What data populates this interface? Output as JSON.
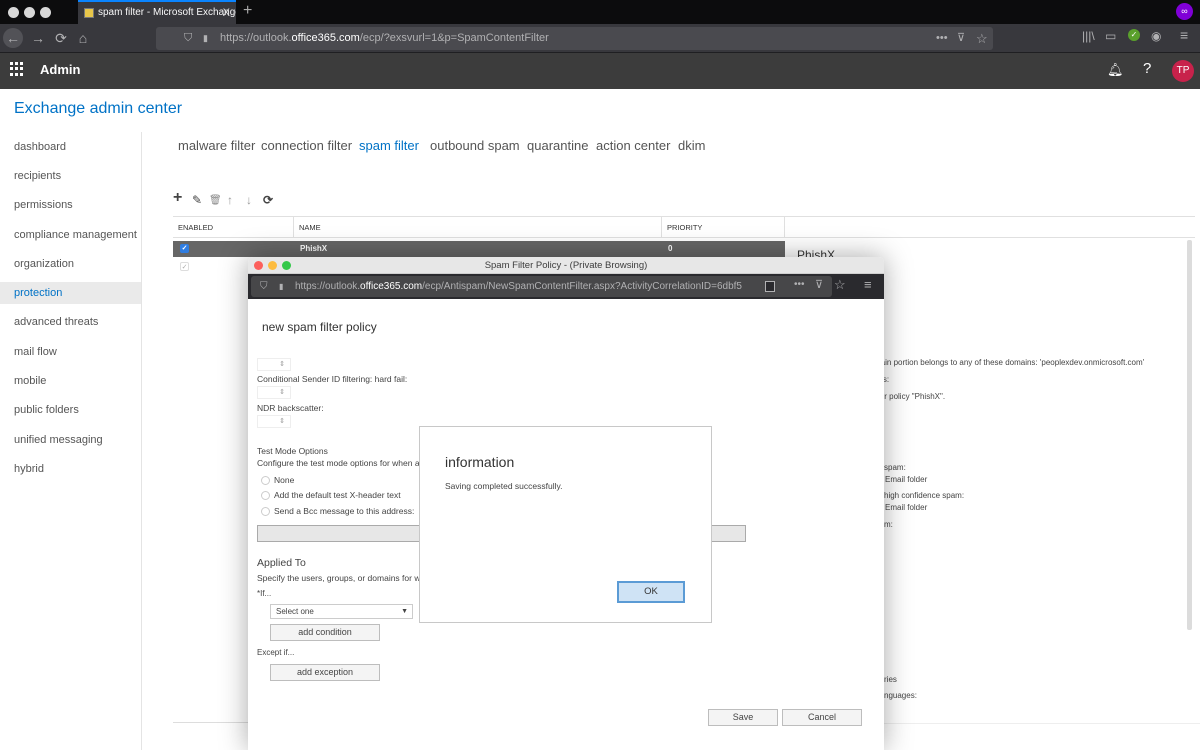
{
  "browser": {
    "tab_title": "spam filter - Microsoft Exchange",
    "tab_close": "X",
    "new_tab": "+",
    "url_prefix": "https://outlook.",
    "url_host": "office365.com",
    "url_path": "/ecp/?exsvurl=1&p=SpamContentFilter",
    "icons": {
      "back": "←",
      "forward": "→",
      "reload": "⟳",
      "home": "⌂",
      "shield": "⛉",
      "lock": "🔒",
      "more": "•••",
      "pocket": "⊽",
      "star": "☆",
      "library": "|||\\",
      "sidebar": "▭",
      "extension": "✓",
      "account": "◉",
      "menu": "≡",
      "private": "∞"
    }
  },
  "o365": {
    "app_name": "Admin",
    "bell_icon": "🔔",
    "help_icon": "?",
    "avatar_initials": "TP"
  },
  "eac": {
    "title": "Exchange admin center",
    "sidebar": [
      {
        "label": "dashboard"
      },
      {
        "label": "recipients"
      },
      {
        "label": "permissions"
      },
      {
        "label": "compliance management"
      },
      {
        "label": "organization"
      },
      {
        "label": "protection",
        "active": true
      },
      {
        "label": "advanced threats"
      },
      {
        "label": "mail flow"
      },
      {
        "label": "mobile"
      },
      {
        "label": "public folders"
      },
      {
        "label": "unified messaging"
      },
      {
        "label": "hybrid"
      }
    ],
    "subtabs": [
      {
        "label": "malware filter"
      },
      {
        "label": "connection filter"
      },
      {
        "label": "spam filter",
        "active": true
      },
      {
        "label": "outbound spam"
      },
      {
        "label": "quarantine"
      },
      {
        "label": "action center"
      },
      {
        "label": "dkim"
      }
    ],
    "toolbar": {
      "add": "+",
      "edit": "✎",
      "delete": "🗑",
      "up": "↑",
      "down": "↓",
      "refresh": "⟳"
    },
    "table": {
      "columns": [
        "ENABLED",
        "NAME",
        "PRIORITY"
      ],
      "rows": [
        {
          "enabled": true,
          "name": "PhishX",
          "priority": "0",
          "selected": true
        },
        {
          "enabled": true,
          "name": "",
          "priority": ""
        }
      ]
    },
    "details": {
      "title": "PhishX",
      "lines": [
        "main portion belongs to any of these domains: 'peoplexdev.onmicrosoft.com'",
        "ons:",
        "ilter policy \"PhishX\".",
        "spam:",
        "Email folder",
        "high confidence spam:",
        "Email folder",
        "m:",
        "ries",
        "nguages:"
      ]
    }
  },
  "popup": {
    "window_title": "Spam Filter Policy - (Private Browsing)",
    "url_prefix": "https://outlook.",
    "url_host": "office365.com",
    "url_path": "/ecp/Antispam/NewSpamContentFilter.aspx?ActivityCorrelationID=6dbf5",
    "heading": "new spam filter policy",
    "labels": {
      "sender_id": "Conditional Sender ID filtering: hard fail:",
      "ndr": "NDR backscatter:",
      "test_mode": "Test Mode Options",
      "test_mode_desc": "Configure the test mode options for when a",
      "applied_to": "Applied To",
      "applied_desc": "Specify the users, groups, or domains for w",
      "if": "*If...",
      "except_if": "Except if..."
    },
    "radio_options": [
      {
        "label": "None"
      },
      {
        "label": "Add the default test X-header text"
      },
      {
        "label": "Send a Bcc message to this address:"
      }
    ],
    "bcc_value": "",
    "condition_select": "Select one",
    "add_condition": "add condition",
    "add_exception": "add exception",
    "save": "Save",
    "cancel": "Cancel"
  },
  "info_dialog": {
    "title": "information",
    "message": "Saving completed successfully.",
    "ok": "OK"
  }
}
